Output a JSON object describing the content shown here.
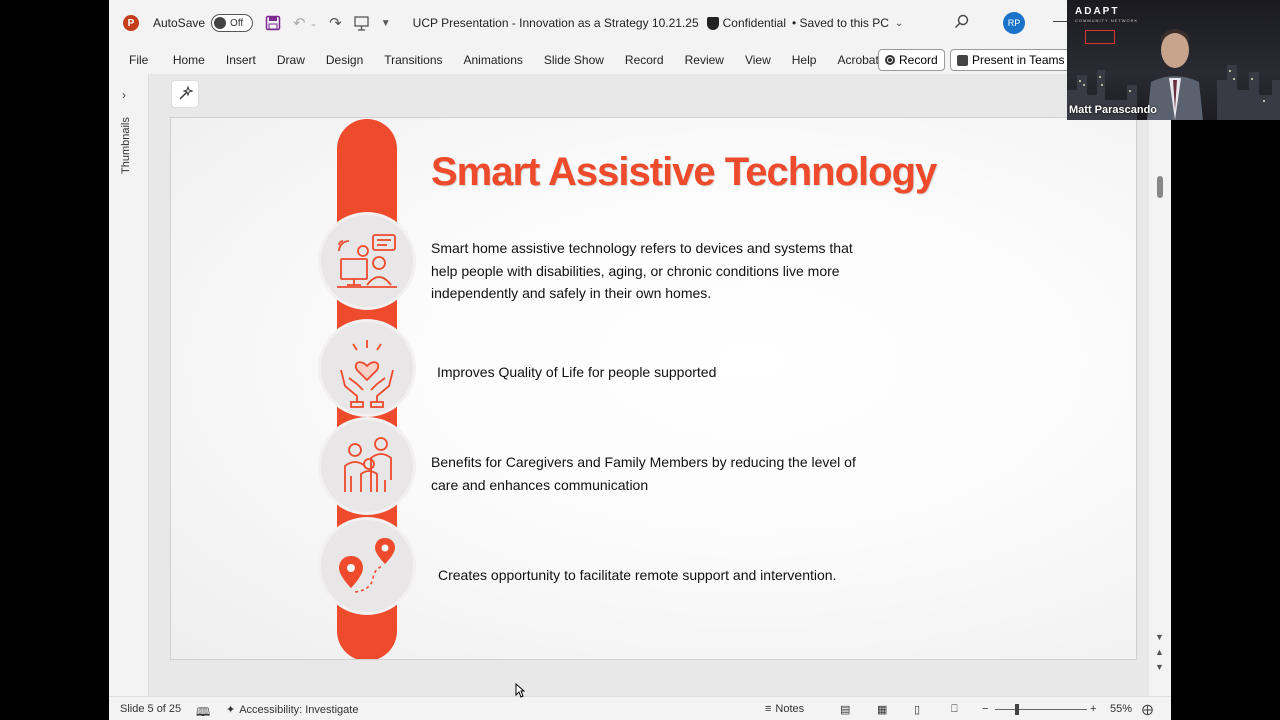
{
  "titlebar": {
    "autosave_label": "AutoSave",
    "autosave_state": "Off",
    "doc_title": "UCP Presentation - Innovation as a Strategy 10.21.25",
    "sensitivity": "Confidential",
    "save_status": "• Saved to this PC",
    "user_initials": "RP",
    "app_icon": "powerpoint-icon"
  },
  "ribbon": {
    "tabs": [
      "File",
      "Home",
      "Insert",
      "Draw",
      "Design",
      "Transitions",
      "Animations",
      "Slide Show",
      "Record",
      "Review",
      "View",
      "Help",
      "Acrobat"
    ],
    "record_button": "Record",
    "teams_button": "Present in Teams"
  },
  "thumbnails_label": "Thumbnails",
  "slide": {
    "title": "Smart Assistive Technology",
    "intro": "Smart home assistive technology refers to devices and systems that help people with disabilities, aging, or chronic conditions live more independently and safely in their own homes.",
    "bullets": [
      "Improves Quality of Life for people supported",
      "Benefits for Caregivers and Family Members by reducing the level of care and enhances communication",
      "Creates opportunity to facilitate remote support and intervention."
    ],
    "accent_color": "#ee4a2c",
    "icons": [
      "smart-home-person-icon",
      "hands-heart-icon",
      "family-icon",
      "location-pins-icon"
    ]
  },
  "status": {
    "slide_info": "Slide 5 of 25",
    "accessibility": "Accessibility: Investigate",
    "notes": "Notes",
    "zoom": "55%"
  },
  "video": {
    "org_text": "ADAPT",
    "org_sub": "COMMUNITY NETWORK",
    "participant": "Matt Parascando"
  }
}
